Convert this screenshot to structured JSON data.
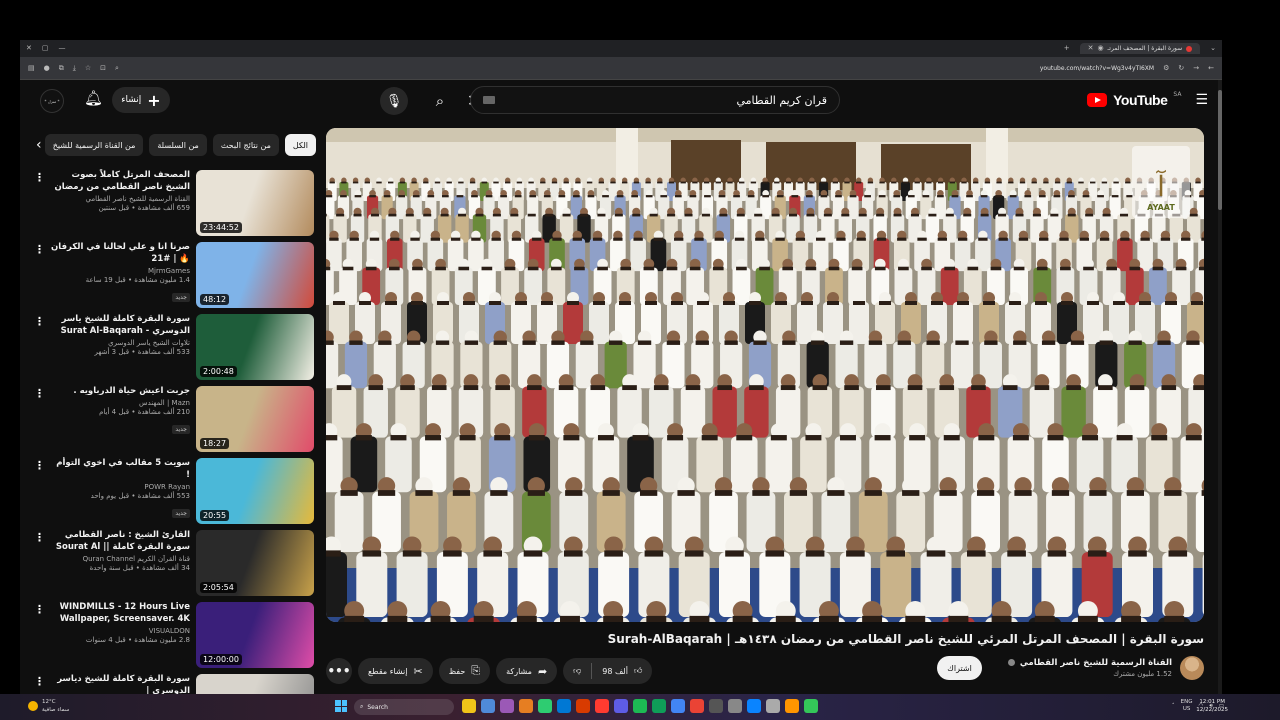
{
  "browser": {
    "tab_title": "سورة البقرة | المصحف المرتـ",
    "url": "youtube.com/watch?v=Wg3v4yTI6XM"
  },
  "header": {
    "logo_text": "YouTube",
    "region": "SA",
    "search_query": "قران كريم القطامي",
    "create_label": "إنشاء",
    "avatar_text": "* منزل *"
  },
  "chips": [
    {
      "label": "الكل",
      "active": true
    },
    {
      "label": "من نتائج البحث"
    },
    {
      "label": "من السلسلة"
    },
    {
      "label": "من القناة الرسمية للشيخ"
    }
  ],
  "recommendations": [
    {
      "title": "المصحف المرتل كاملاً بصوت الشيخ ناصر القطامي من رمضان 1444هـ.",
      "channel": "القناة الرسمية للشيخ ناصر القطامي",
      "meta": "659 ألف مشاهدة • قبل سنتين",
      "badge": "",
      "duration": "23:44:52",
      "thumb_colors": [
        "#e8e2d6",
        "#b38b5d"
      ]
    },
    {
      "title": "صرنا انا و علي لحالنا في الكرفان 🔥 | #21",
      "channel": "MjrmGames",
      "meta": "1.4 مليون مشاهدة • قبل 19 ساعة",
      "badge": "جديد",
      "duration": "48:12",
      "thumb_colors": [
        "#7fb3e8",
        "#d24a3a"
      ]
    },
    {
      "title": "سورة البقرة كاملة للشيخ ياسر الدوسري - Surat Al-Baqarah",
      "channel": "تلاوات الشيخ ياسر الدوسري",
      "meta": "533 ألف مشاهدة • قبل 3 أشهر",
      "badge": "",
      "duration": "2:00:48",
      "thumb_colors": [
        "#1e5d3a",
        "#f4f0e6"
      ]
    },
    {
      "title": "جربت اعيش حياة الدرباويه .",
      "channel": "Mazn | المهندس",
      "meta": "210 ألف مشاهدة • قبل 4 أيام",
      "badge": "جديد",
      "duration": "18:27",
      "thumb_colors": [
        "#c8b489",
        "#e14b6a"
      ]
    },
    {
      "title": "سويت 5 مقالب في اخوي التوأم !",
      "channel": "POWR Rayan",
      "meta": "553 ألف مشاهدة • قبل يوم واحد",
      "badge": "جديد",
      "duration": "20:55",
      "thumb_colors": [
        "#4bb8d8",
        "#e7b93a"
      ]
    },
    {
      "title": "القارئ الشيخ : ناصر القطامي سورة البقرة كاملة || Sourat Al baqarah -",
      "channel": "قناة القرآن الكريم Quran Channel",
      "meta": "34 ألف مشاهدة • قبل سنة واحدة",
      "badge": "",
      "duration": "2:05:54",
      "thumb_colors": [
        "#2a2a2a",
        "#c9a24a"
      ]
    },
    {
      "title": "WINDMILLS - 12 Hours Live Wallpaper, Screensaver. 4K Ultra...",
      "channel": "VISUALDON",
      "meta": "2.8 مليون مشاهدة • قبل 4 سنوات",
      "badge": "",
      "duration": "12:00:00",
      "thumb_colors": [
        "#3a1f7a",
        "#e04da8"
      ]
    },
    {
      "title": "سورة البقرة كاملة للشيخ دياسر الدوسري |",
      "channel": "",
      "meta": "",
      "badge": "",
      "duration": "",
      "thumb_colors": [
        "#d8d4cc",
        "#8a8a8a"
      ]
    }
  ],
  "video": {
    "title": "سورة البقرة | المصحف المرتل المرئي للشيخ ناصر القطامي من رمضان ١٤٣٨هـ | Surah-AlBaqarah",
    "watermark_text": "AYAAT",
    "channel": "القناة الرسمية للشيخ ناصر القطامي",
    "subscribers": "1.52 مليون مشترك",
    "subscribe_label": "اشتراك",
    "likes": "98 ألف",
    "share_label": "مشاركة",
    "save_label": "حفظ",
    "clip_label": "إنشاء مقطع",
    "more_label": "•••"
  },
  "taskbar": {
    "weather_temp": "12°C",
    "weather_desc": "سماء صافية",
    "search_label": "Search",
    "lang": "ENG",
    "region": "US",
    "time": "12:01 PM",
    "date": "12/22/2025"
  }
}
